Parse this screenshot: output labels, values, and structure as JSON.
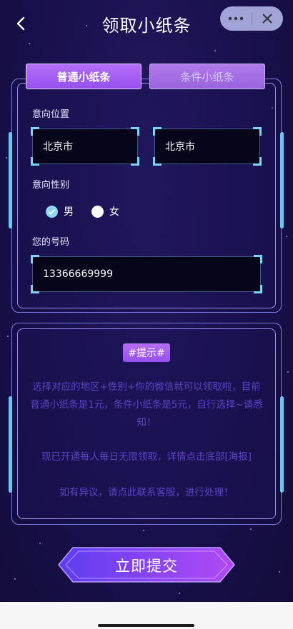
{
  "header": {
    "title": "领取小纸条",
    "back_icon": "chevron-left-icon",
    "more_icon": "more-dots-icon",
    "close_icon": "close-icon"
  },
  "tabs": [
    {
      "label": "普通小纸条",
      "active": true
    },
    {
      "label": "条件小纸条",
      "active": false
    }
  ],
  "form": {
    "location_label": "意向位置",
    "location_values": [
      "北京市",
      "北京市"
    ],
    "gender_label": "意向性别",
    "gender_options": [
      {
        "label": "男",
        "checked": true
      },
      {
        "label": "女",
        "checked": false
      }
    ],
    "phone_label": "您的号码",
    "phone_value": "13366669999"
  },
  "notice": {
    "tag": "#提示#",
    "paragraphs": [
      "选择对应的地区+性别+你的微信就可以领取啦，目前普通小纸条是1元，条件小纸条是5元，自行选择~请悉知！",
      "现已开通每人每日无限领取，详情点击底部[海报]",
      "如有异议，请点此联系客服，进行处理！"
    ]
  },
  "submit": {
    "label": "立即提交"
  },
  "colors": {
    "background": "#1a1150",
    "accent_purple": "#9650ef",
    "accent_cyan": "#7fd4f5",
    "notice_text": "#5b43c5"
  }
}
